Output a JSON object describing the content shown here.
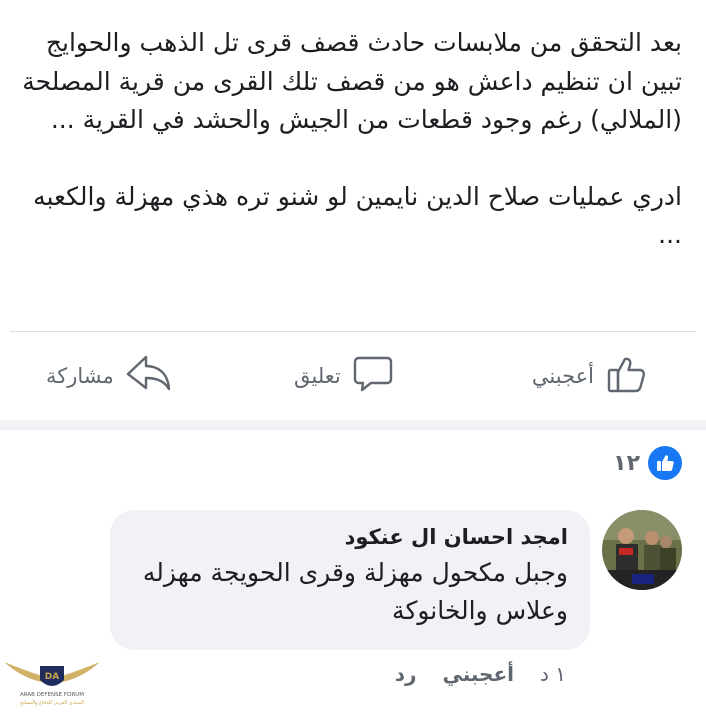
{
  "post": {
    "paragraph1": "بعد التحقق من ملابسات حادث قصف قرى تل الذهب والحوايج تبين ان تنظيم داعش هو من قصف تلك القرى من قرية المصلحة (الملالي) رغم وجود قطعات من الجيش والحشد في القرية ...",
    "paragraph2": "ادري عمليات صلاح الدين نايمين لو شنو تره هذي مهزلة والكعبه ..."
  },
  "actions": {
    "like_label": "أعجبني",
    "comment_label": "تعليق",
    "share_label": "مشاركة"
  },
  "reactions": {
    "count": "١٢",
    "icon": "thumbs-up"
  },
  "comment": {
    "author": "امجد احسان ال عنكود",
    "text": "وجبل مكحول مهزلة وقرى الحويجة مهزله وعلاس والخانوكة",
    "time": "١ د",
    "like_label": "أعجبني",
    "reply_label": "رد"
  },
  "watermark": {
    "badge": "DA",
    "name": "ARAB DEFENSE FORUM",
    "subtitle": "المنتدى العربي للدفاع والتسليح"
  },
  "colors": {
    "facebook_blue": "#1877f2",
    "gray_text": "#606770",
    "bubble_bg": "#f0f2f5"
  }
}
